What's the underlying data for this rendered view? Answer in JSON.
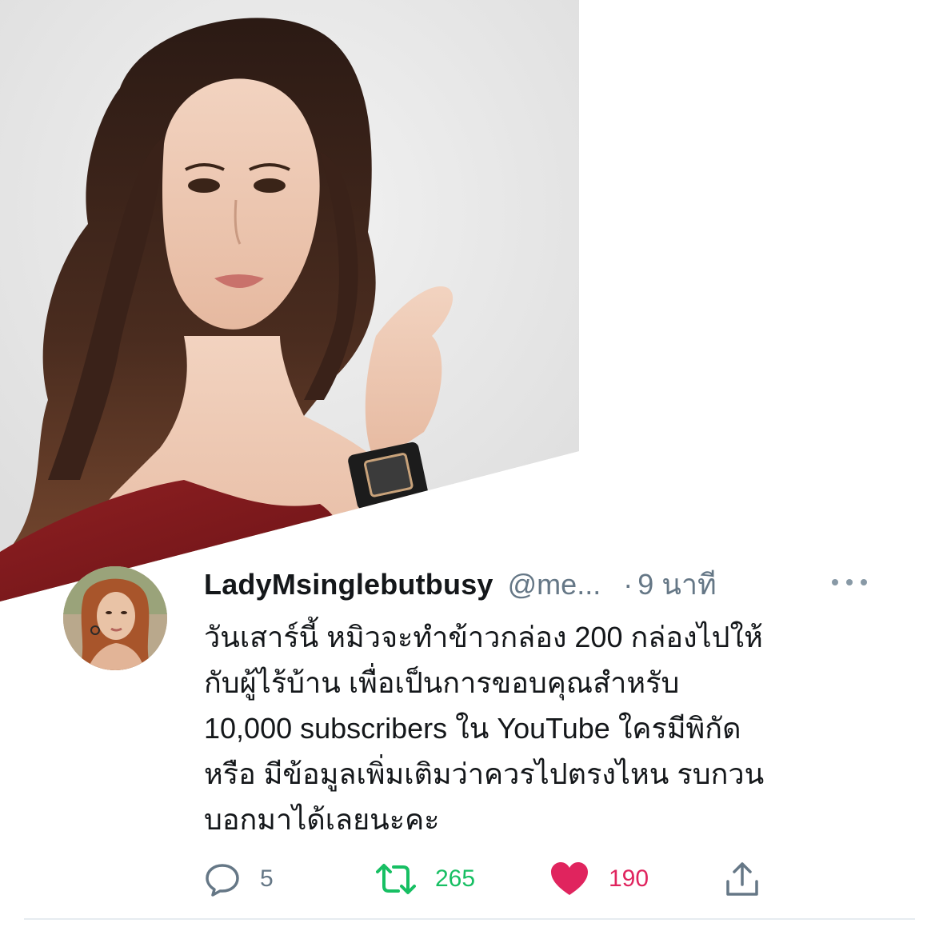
{
  "tweet": {
    "display_name": "LadyMsinglebutbusy",
    "handle": "@me...",
    "separator": "·",
    "time": "9 นาที",
    "body_lines": [
      "วันเสาร์นี้ หมิวจะทำข้าวกล่อง 200 กล่องไปให้",
      "กับผู้ไร้บ้าน เพื่อเป็นการขอบคุณสำหรับ",
      "10,000 subscribers ใน YouTube ใครมีพิกัด",
      "หรือ มีข้อมูลเพิ่มเติมว่าควรไปตรงไหน รบกวน",
      "บอกมาได้เลยนะคะ"
    ],
    "actions": {
      "reply_count": "5",
      "retweet_count": "265",
      "like_count": "190"
    }
  },
  "icons": {
    "reply": "reply-icon",
    "retweet": "retweet-icon",
    "like": "heart-icon",
    "share": "share-icon",
    "more": "more-icon"
  },
  "colors": {
    "retweet_green": "#17bf63",
    "like_pink": "#e0245e",
    "secondary_gray": "#657786",
    "text_dark": "#14171a"
  }
}
